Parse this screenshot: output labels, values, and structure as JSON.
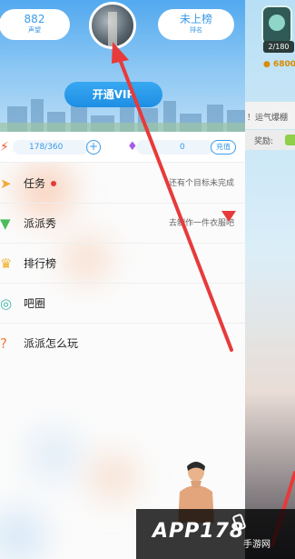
{
  "header": {
    "left_stat": {
      "value": "882",
      "label": "声望"
    },
    "right_stat": {
      "value": "未上榜",
      "label": "排名"
    },
    "vip_button": "开通VIP"
  },
  "resources": {
    "energy": "178/360",
    "gems": "0",
    "recharge_label": "充值"
  },
  "menu": {
    "items": [
      {
        "label": "任务",
        "hint": "还有个目标未完成",
        "icon": "paper-plane-icon",
        "color": "#f2a93b"
      },
      {
        "label": "派派秀",
        "hint": "去制作一件衣服吧",
        "icon": "shirt-icon",
        "color": "#4cbb5a"
      },
      {
        "label": "排行榜",
        "hint": "",
        "icon": "crown-icon",
        "color": "#f2b12b"
      },
      {
        "label": "吧圈",
        "hint": "",
        "icon": "chat-icon",
        "color": "#3fb5a5"
      },
      {
        "label": "派派怎么玩",
        "hint": "",
        "icon": "question-icon",
        "color": "#f07a3a"
      }
    ]
  },
  "background": {
    "level_count": "2/180",
    "coins": "6800",
    "notice": "！运气爆棚",
    "reward_label": "奖励:"
  },
  "watermark": {
    "logo": "APP178",
    "sub": "手游网"
  },
  "colors": {
    "accent": "#3b9be8",
    "arrow": "#e83a3a"
  }
}
